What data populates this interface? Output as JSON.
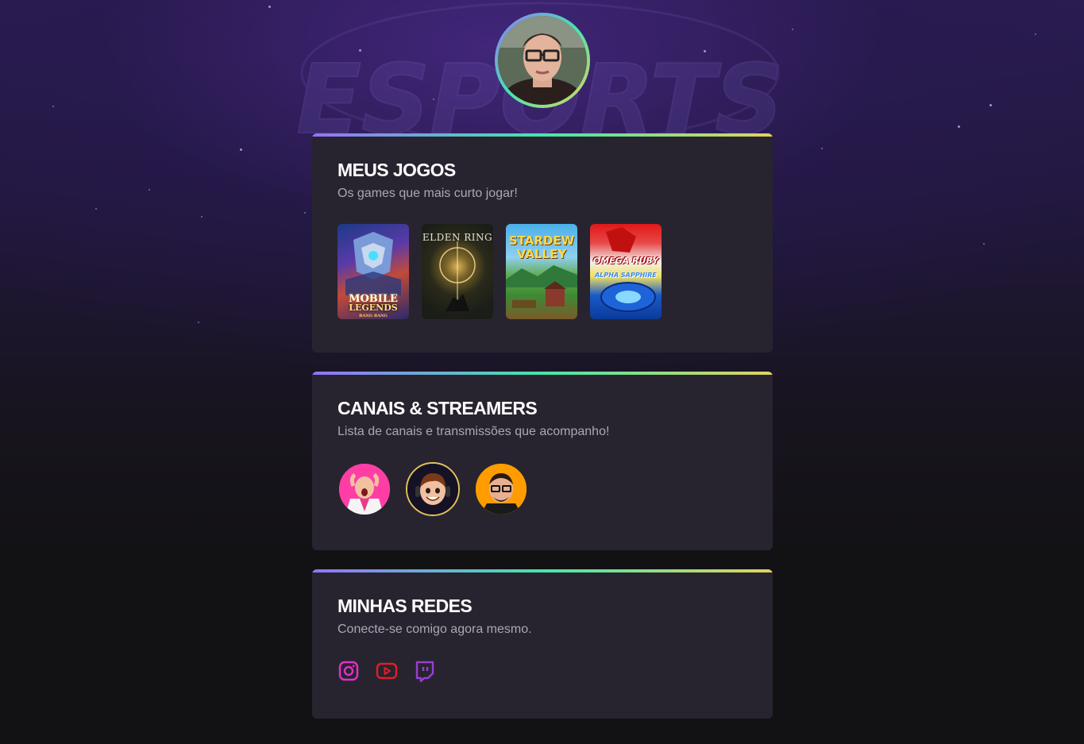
{
  "profile": {
    "avatar_alt": "Foto de perfil"
  },
  "background": {
    "logo_text": "ESPORTS"
  },
  "games_section": {
    "title": "MEUS JOGOS",
    "subtitle": "Os games que mais curto jogar!",
    "games": [
      {
        "name": "Mobile Legends",
        "cover_line1": "MOBILE",
        "cover_line2": "LEGENDS",
        "cover_line3": "BANG BANG"
      },
      {
        "name": "Elden Ring",
        "cover_line1": "ELDEN RING"
      },
      {
        "name": "Stardew Valley",
        "cover_line1": "STARDEW",
        "cover_line2": "VALLEY"
      },
      {
        "name": "Pokémon Omega Ruby / Alpha Sapphire",
        "cover_line1": "OMEGA RUBY",
        "cover_line2": "ALPHA SAPPHIRE"
      }
    ]
  },
  "streamers_section": {
    "title": "CANAIS & STREAMERS",
    "subtitle": "Lista de canais e transmissões que acompanho!",
    "streamers": [
      {
        "icon": "streamer-1-avatar",
        "accent": "#ff3ea5"
      },
      {
        "icon": "streamer-2-avatar",
        "accent": "#e2c35c"
      },
      {
        "icon": "streamer-3-avatar",
        "accent": "#ffa500"
      }
    ]
  },
  "social_section": {
    "title": "MINHAS REDES",
    "subtitle": "Conecte-se comigo agora mesmo.",
    "links": [
      {
        "icon": "instagram-icon",
        "color": "#e230c8"
      },
      {
        "icon": "youtube-icon",
        "color": "#e11d2a"
      },
      {
        "icon": "twitch-icon",
        "color": "#9b3dd6"
      }
    ]
  },
  "colors": {
    "gradient_start": "#9572fc",
    "gradient_mid": "#43e7ad",
    "gradient_end": "#e2d45c",
    "card_bg": "#28242f",
    "page_bg": "#121214"
  }
}
